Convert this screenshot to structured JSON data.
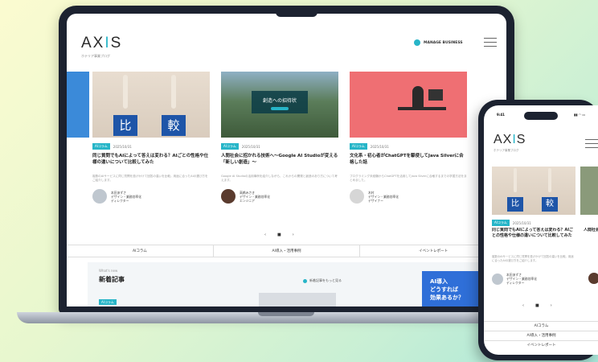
{
  "laptop": {
    "logo": {
      "part1": "AX",
      "dot": "I",
      "part2": "S",
      "subtitle": "ホテリア事業ブログ"
    },
    "contact_label": "MANAGE BUSINESS",
    "cards": [
      {
        "tag": "",
        "date": "",
        "title": "",
        "excerpt": "",
        "author_name": "",
        "author_org": ""
      },
      {
        "tag": "AIコラム",
        "date": "2025/10/31",
        "title": "同じ質問でもAIによって答えは変わる？AIごとの性格や仕様の違いについて比較してみた",
        "excerpt": "複数のAIサービスに同じ質問を投げかけて回答の違いを比較。用途に合ったAIの選び方をご紹介します。",
        "author_name": "本田あずさ",
        "author_org": "デザイン・業務効率化",
        "author_role": "ディレクター",
        "blocks": [
          "比",
          "較"
        ]
      },
      {
        "tag": "AIコラム",
        "date": "2025/10/31",
        "title": "人間社会に招かれる技術へ〜Google AI Studioが変える「新しい創造」〜",
        "excerpt": "Google AI Studioの活用事例を紹介しながら、これからの開発と創造のあり方について考えます。",
        "author_name": "高橋みさき",
        "author_org": "デザイン・業務効率化",
        "author_role": "エンジニア",
        "banner": "創造への招待状"
      },
      {
        "tag": "AIコラム",
        "date": "2025/10/31",
        "title": "文化系・初心者がChatGPTを駆使してJava Silverに合格した話",
        "excerpt": "プログラミング未経験からChatGPTを活用してJava Silverに合格するまでの学習方法をまとめました。",
        "author_name": "木村　",
        "author_org": "デザイン・業務効率化",
        "author_role": "デザイナー"
      }
    ],
    "pager": {
      "prev": "‹",
      "current": "■",
      "next": "›"
    },
    "categories": [
      "AIコラム",
      "AI導入・活用事例",
      "イベントレポート"
    ],
    "latest": {
      "en": "What's new",
      "title": "新着記事",
      "view_all": "新着記事をもっと見る",
      "tag": "AIコラム"
    },
    "ad": {
      "line1": "AI導入",
      "line2": "どうすれば",
      "line3": "効果あるか？"
    }
  },
  "phone": {
    "time": "9:41",
    "status": "▮▮ ◠ ▭",
    "logo": {
      "part1": "AX",
      "dot": "I",
      "part2": "S",
      "subtitle": "ホテリア事業ブログ"
    },
    "card": {
      "tag": "AIコラム",
      "date": "2025/10/31",
      "title": "同じ質問でもAIによって答えは変わる？AIごとの性格や仕様の違いについて比較してみた",
      "excerpt": "複数のAIサービスに同じ質問を投げかけて回答の違いを比較。用途に合ったAIの選び方をご紹介します。",
      "author_name": "本田あずさ",
      "author_org": "デザイン・業務効率化",
      "author_role": "ディレクター",
      "blocks": [
        "比",
        "較"
      ]
    },
    "next_card_title": "人間社会 Google 創造",
    "pager": {
      "prev": "‹",
      "current": "■",
      "next": "›"
    },
    "categories": [
      "AIコラム",
      "AI導入・活用事例",
      "イベントレポート"
    ]
  },
  "colors": {
    "accent": "#27b5c8",
    "tag_bg": "#27b5c8",
    "dark_frame": "#1c2230",
    "block_blue": "#1e55a8"
  }
}
